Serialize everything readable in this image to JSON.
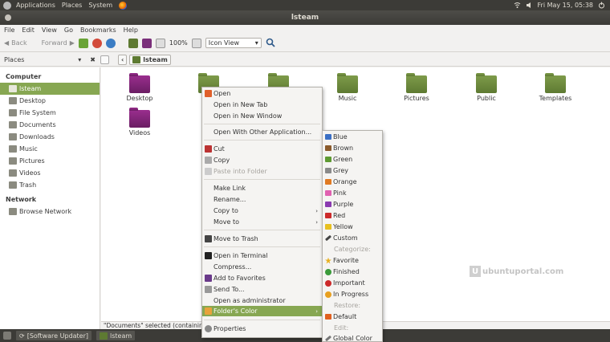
{
  "top_panel": {
    "menus": [
      "Applications",
      "Places",
      "System"
    ],
    "datetime": "Fri May 15, 05:38"
  },
  "window": {
    "title": "lsteam"
  },
  "menubar": [
    "File",
    "Edit",
    "View",
    "Go",
    "Bookmarks",
    "Help"
  ],
  "toolbar": {
    "back": "Back",
    "forward": "Forward",
    "zoom": "100%",
    "view_mode": "Icon View"
  },
  "location": {
    "places_label": "Places",
    "crumb": "lsteam"
  },
  "sidebar": {
    "computer_header": "Computer",
    "items": [
      "lsteam",
      "Desktop",
      "File System",
      "Documents",
      "Downloads",
      "Music",
      "Pictures",
      "Videos",
      "Trash"
    ],
    "network_header": "Network",
    "network_items": [
      "Browse Network"
    ]
  },
  "files": [
    {
      "name": "Desktop",
      "color": "#8a2a80"
    },
    {
      "name": "Do",
      "color": "#5e7a32"
    },
    {
      "name": "",
      "color": "#7e9b4a"
    },
    {
      "name": "Music",
      "color": "#7e9b4a"
    },
    {
      "name": "Pictures",
      "color": "#7e9b4a"
    },
    {
      "name": "Public",
      "color": "#7e9b4a"
    },
    {
      "name": "Templates",
      "color": "#7e9b4a"
    },
    {
      "name": "Videos",
      "color": "#8a2a80"
    }
  ],
  "status": "\"Documents\" selected (containing",
  "taskbar": [
    "[Software Updater]",
    "lsteam"
  ],
  "context_menu": [
    "Open",
    "Open in New Tab",
    "Open in New Window",
    "Open With Other Application...",
    "Cut",
    "Copy",
    "Paste into Folder",
    "Make Link",
    "Rename...",
    "Copy to",
    "Move to",
    "Move to Trash",
    "Open in Terminal",
    "Compress...",
    "Add to Favorites",
    "Send To...",
    "Open as administrator",
    "Folder's Color",
    "Properties"
  ],
  "color_submenu": {
    "colors": [
      "Blue",
      "Brown",
      "Green",
      "Grey",
      "Orange",
      "Pink",
      "Purple",
      "Red",
      "Yellow",
      "Custom"
    ],
    "categorize_label": "Categorize:",
    "categories": [
      "Favorite",
      "Finished",
      "Important",
      "In Progress"
    ],
    "restore_label": "Restore:",
    "restore": "Default",
    "edit_label": "Edit:",
    "edit": "Global Color"
  },
  "watermark": {
    "letter": "U",
    "text": "ubuntuportal.com"
  }
}
